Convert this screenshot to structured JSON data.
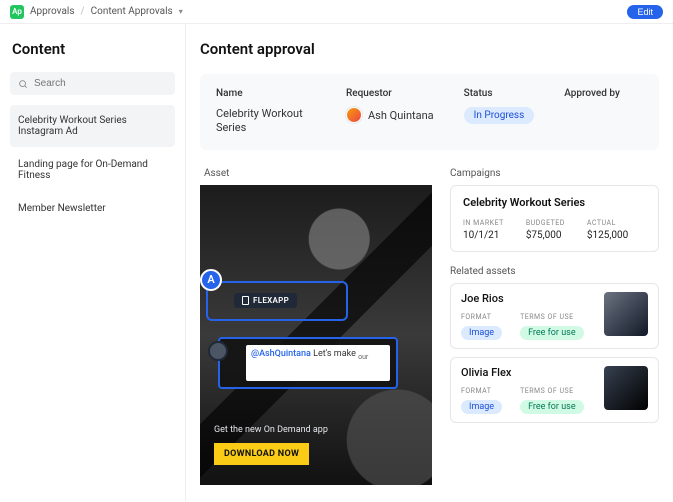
{
  "topbar": {
    "app_badge": "Ap",
    "crumb1": "Approvals",
    "crumb2": "Content Approvals",
    "edit_label": "Edit"
  },
  "sidebar": {
    "heading": "Content",
    "search_placeholder": "Search",
    "items": [
      {
        "label": "Celebrity Workout Series Instagram Ad"
      },
      {
        "label": "Landing page for On-Demand Fitness"
      },
      {
        "label": "Member Newsletter"
      }
    ]
  },
  "main": {
    "heading": "Content approval",
    "summary": {
      "name_label": "Name",
      "name_value": "Celebrity Workout Series",
      "requestor_label": "Requestor",
      "requestor_value": "Ash Quintana",
      "status_label": "Status",
      "status_value": "In Progress",
      "approved_label": "Approved by"
    },
    "asset": {
      "label": "Asset",
      "marker": "A",
      "tag_text": "FLEXAPP",
      "comment_mention": "@AshQuintana",
      "comment_text": " Let's make ",
      "comment_typed": "our",
      "promo_line": "Get the new On Demand app",
      "download_btn": "DOWNLOAD NOW"
    },
    "campaigns": {
      "label": "Campaigns",
      "card": {
        "title": "Celebrity Workout Series",
        "metrics": [
          {
            "label": "IN MARKET",
            "value": "10/1/21"
          },
          {
            "label": "BUDGETED",
            "value": "$75,000"
          },
          {
            "label": "ACTUAL",
            "value": "$125,000"
          }
        ]
      }
    },
    "related": {
      "label": "Related assets",
      "items": [
        {
          "name": "Joe Rios",
          "format_label": "FORMAT",
          "format_value": "Image",
          "terms_label": "TERMS OF USE",
          "terms_value": "Free for use"
        },
        {
          "name": "Olivia Flex",
          "format_label": "FORMAT",
          "format_value": "Image",
          "terms_label": "TERMS OF USE",
          "terms_value": "Free for use"
        }
      ]
    }
  }
}
